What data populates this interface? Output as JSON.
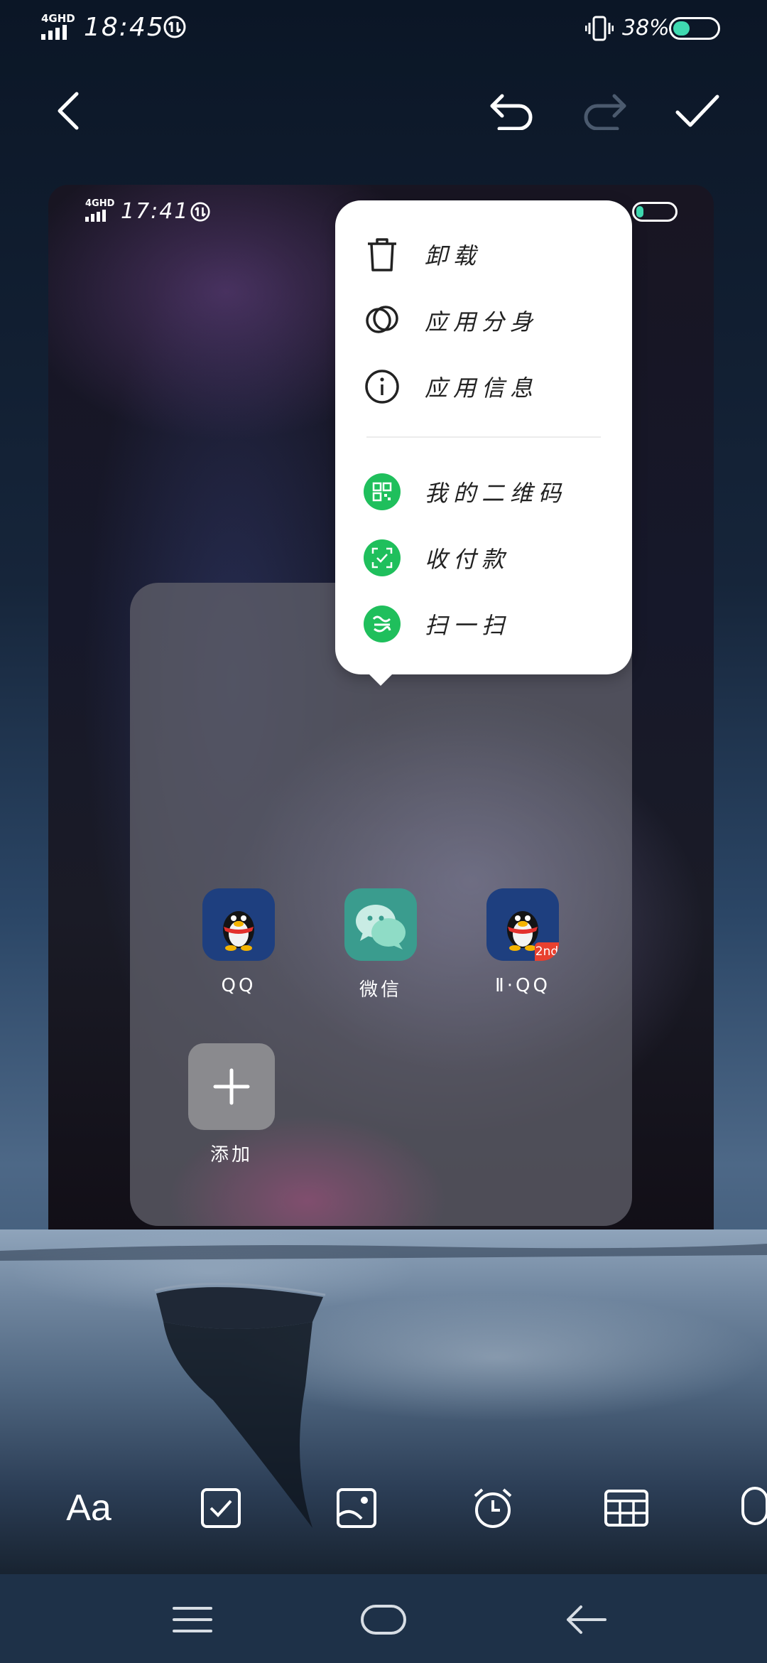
{
  "status_bar": {
    "network": "4GHD",
    "time": "18:45",
    "battery": "38%",
    "battery_level": 0.38
  },
  "toolbar": {
    "back_icon": "chevron-left-icon",
    "undo_icon": "undo-icon",
    "redo_icon": "redo-icon",
    "confirm_icon": "checkmark-icon",
    "redo_enabled": false
  },
  "screenshot": {
    "status_bar": {
      "network": "4GHD",
      "time": "17:41"
    },
    "popup_menu": {
      "items": [
        {
          "label": "卸载",
          "icon": "trash-icon"
        },
        {
          "label": "应用分身",
          "icon": "clone-icon"
        },
        {
          "label": "应用信息",
          "icon": "info-icon"
        }
      ],
      "shortcuts": [
        {
          "label": "我的二维码",
          "icon": "qrcode-icon",
          "color": "#1fbf5c"
        },
        {
          "label": "收付款",
          "icon": "payment-icon",
          "color": "#1fbf5c"
        },
        {
          "label": "扫一扫",
          "icon": "scan-icon",
          "color": "#1fbf5c"
        }
      ]
    },
    "folder": {
      "apps": [
        {
          "label": "QQ",
          "icon": "qq-penguin-icon"
        },
        {
          "label": "微信",
          "icon": "wechat-icon"
        },
        {
          "label": "Ⅱ·QQ",
          "icon": "qq-penguin-icon",
          "badge": "2nd"
        },
        {
          "label": "添加",
          "icon": "plus-icon"
        }
      ]
    }
  },
  "bottom_tools": [
    {
      "label": "Aa",
      "icon": "text-format-icon"
    },
    {
      "icon": "checkbox-icon"
    },
    {
      "icon": "image-icon"
    },
    {
      "icon": "alarm-clock-icon"
    },
    {
      "icon": "table-icon"
    },
    {
      "icon": "microphone-icon"
    }
  ],
  "navigation": {
    "icons": [
      "menu-icon",
      "home-icon",
      "back-arrow-icon"
    ]
  }
}
